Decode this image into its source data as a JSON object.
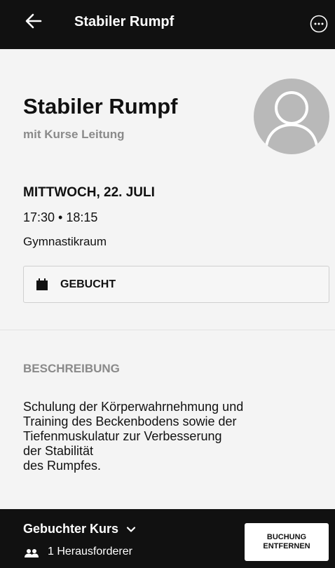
{
  "topbar": {
    "title": "Stabiler Rumpf"
  },
  "course": {
    "title": "Stabiler Rumpf",
    "instructor": "mit Kurse Leitung",
    "date": "MITTWOCH, 22. JULI",
    "time": "17:30 • 18:15",
    "room": "Gymnastikraum",
    "booking_status": "GEBUCHT"
  },
  "description": {
    "heading": "BESCHREIBUNG",
    "text": "Schulung der Körperwahrnehmung und\nTraining des Beckenbodens sowie der\nTiefenmuskulatur zur Verbesserung\nder Stabilität\ndes Rumpfes."
  },
  "bottombar": {
    "booked_course_label": "Gebuchter Kurs",
    "participants": "1 Herausforderer",
    "remove_button": "BUCHUNG\nENTFERNEN"
  },
  "icons": {
    "back": "arrow-left-icon",
    "more": "more-horizontal-circle-icon",
    "avatar": "user-placeholder-icon",
    "booked": "calendar-icon",
    "chevron": "chevron-down-icon",
    "participants": "people-icon"
  },
  "colors": {
    "bar": "#111111",
    "background": "#f4f4f4",
    "muted_text": "#8a8a8a",
    "avatar_bg": "#b9b9b9"
  }
}
